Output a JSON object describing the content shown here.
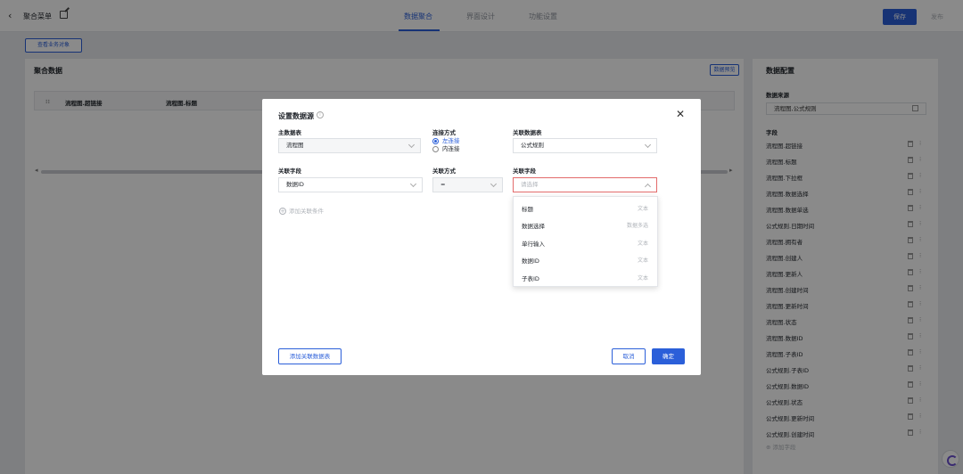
{
  "header": {
    "back_icon": "‹",
    "title": "聚合菜单",
    "tabs": [
      {
        "label": "数据聚合",
        "active": true
      },
      {
        "label": "界面设计",
        "active": false
      },
      {
        "label": "功能设置",
        "active": false
      }
    ],
    "save_label": "保存",
    "publish_label": "发布"
  },
  "left": {
    "view_objects_label": "查看业务对象",
    "section_title": "聚合数据",
    "preview_label": "数据预览",
    "columns": [
      "流程图.超链接",
      "流程图.标题"
    ]
  },
  "right": {
    "title": "数据配置",
    "source_heading": "数据来源",
    "source_value": "流程图,公式规则",
    "fields_heading": "字段",
    "fields": [
      "流程图.超链接",
      "流程图.标题",
      "流程图.下拉框",
      "流程图.数据选择",
      "流程图.数据单选",
      "公式规则.日期时间",
      "流程图.拥有者",
      "流程图.创建人",
      "流程图.更新人",
      "流程图.创建时间",
      "流程图.更新时间",
      "流程图.状态",
      "流程图.数据ID",
      "流程图.子表ID",
      "公式规则.子表ID",
      "公式规则.数据ID",
      "公式规则.状态",
      "公式规则.更新时间",
      "公式规则.创建时间"
    ],
    "add_field_label": "添加字段"
  },
  "dialog": {
    "title": "设置数据源",
    "info_icon": "i",
    "close_icon": "✕",
    "main_table_label": "主数据表",
    "main_table_value": "流程图",
    "join_method_label": "连接方式",
    "join_options": [
      {
        "label": "左连接",
        "selected": true
      },
      {
        "label": "内连接",
        "selected": false
      }
    ],
    "related_table_label": "关联数据表",
    "related_table_value": "公式规则",
    "related_field_label": "关联字段",
    "related_field_value": "数据ID",
    "relation_method_label": "关联方式",
    "relation_method_value": "=",
    "target_field_label": "关联字段",
    "target_field_placeholder": "请选择",
    "add_condition_label": "添加关联条件",
    "add_table_label": "添加关联数据表",
    "cancel_label": "取消",
    "confirm_label": "确定"
  },
  "dropdown": {
    "options": [
      {
        "name": "标题",
        "type": "文本"
      },
      {
        "name": "数据选择",
        "type": "数据多选"
      },
      {
        "name": "单行输入",
        "type": "文本"
      },
      {
        "name": "数据ID",
        "type": "文本"
      },
      {
        "name": "子表ID",
        "type": "文本"
      }
    ]
  },
  "colors": {
    "accent": "#2b5fd9",
    "error_border": "#e36b6b"
  }
}
